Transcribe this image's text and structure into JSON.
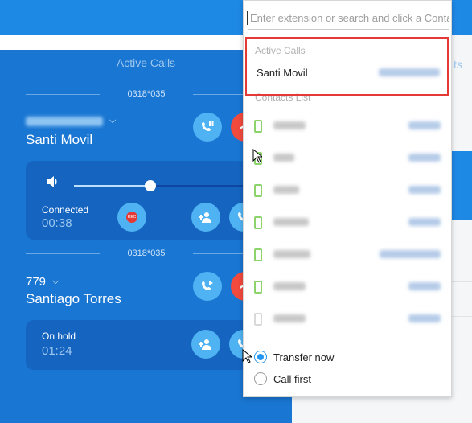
{
  "search": {
    "placeholder": "Enter extension or search and click a Conta"
  },
  "panel": {
    "title": "Active Calls",
    "calls": [
      {
        "line_id": "0318*035",
        "caller_name": "Santi Movil",
        "status": "Connected",
        "time": "00:38",
        "volume_level": 0.38,
        "record_label": "REC"
      },
      {
        "line_id": "0318*035",
        "number": "779",
        "caller_name": "Santiago Torres",
        "status": "On hold",
        "time": "01:24"
      }
    ]
  },
  "right_panel": {
    "truncated_text": "ts"
  },
  "popup": {
    "active_section_title": "Active Calls",
    "active_call_name": "Santi Movil",
    "contacts_section_title": "Contacts List",
    "contact_count": 7,
    "transfer_options": [
      {
        "label": "Transfer now",
        "checked": true
      },
      {
        "label": "Call first",
        "checked": false
      }
    ]
  },
  "colors": {
    "panel_blue": "#1976d2",
    "accent_blue": "#4fb3f3",
    "hangup_red": "#f24a3d",
    "highlight_red": "#e53935",
    "presence_green": "#8bd36a"
  },
  "icons": [
    "pause-icon",
    "hangup-icon",
    "speaker-icon",
    "record-icon",
    "add-participant-icon",
    "transfer-icon",
    "chevron-down-icon",
    "presence-icon",
    "mouse-pointer-icon"
  ]
}
